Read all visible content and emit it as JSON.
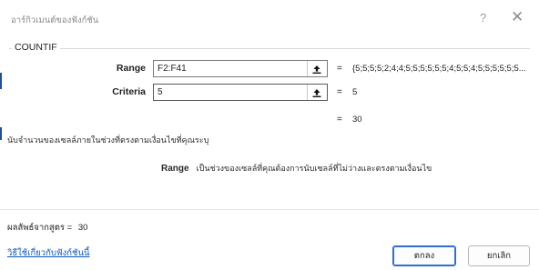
{
  "dialog": {
    "title": "อาร์กิวเมนต์ของฟังก์ชัน",
    "help_glyph": "?",
    "close_glyph": "✕"
  },
  "function": {
    "name": "COUNTIF",
    "args": [
      {
        "label": "Range",
        "value": "F2:F41",
        "result": "{5;5;5;5;2;4;4;5;5;5;5;5;5;4;5;5;4;5;5;5;5;5;5..."
      },
      {
        "label": "Criteria",
        "value": "5",
        "result": "5"
      }
    ],
    "equals": "=",
    "total_result": "30"
  },
  "description": {
    "function_text": "นับจำนวนของเซลล์ภายในช่วงที่ตรงตามเงื่อนไขที่คุณระบุ",
    "arg_name": "Range",
    "arg_text": "เป็นช่วงของเซลล์ที่คุณต้องการนับเซลล์ที่ไม่ว่างและตรงตามเงื่อนไข"
  },
  "footer": {
    "formula_result_label": "ผลลัพธ์จากสูตร =",
    "formula_result_value": "30",
    "help_link": "วิธีใช้เกี่ยวกับฟังก์ชันนี้",
    "ok_label": "ตกลง",
    "cancel_label": "ยกเลิก"
  },
  "icons": {
    "collapse": "collapse-dialog-icon"
  },
  "colors": {
    "link": "#0a56c2",
    "ok_border": "#2f6fd1"
  }
}
